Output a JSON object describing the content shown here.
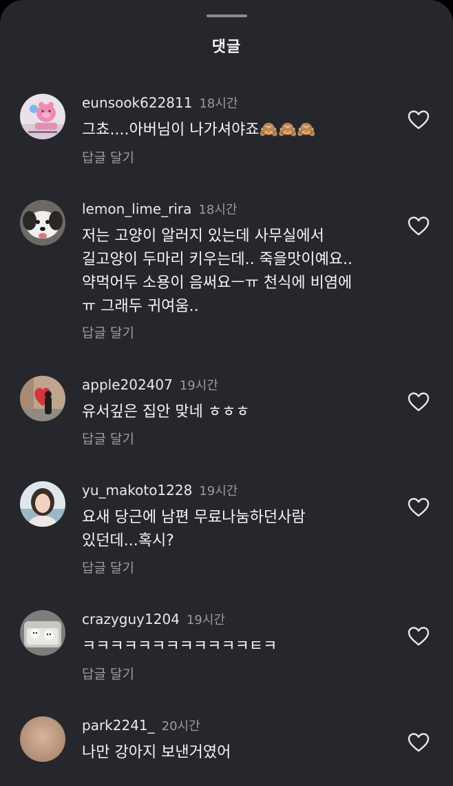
{
  "header": {
    "title": "댓글"
  },
  "comments": [
    {
      "username": "eunsook622811",
      "time": "18시간",
      "text": "그쵸....아버님이 나가셔야죠🙈🙈🙈",
      "reply_label": "답글 달기",
      "avatar_icon": "pig-plush-photo"
    },
    {
      "username": "lemon_lime_rira",
      "time": "18시간",
      "text": "저는 고양이 알러지 있는데 사무실에서\n길고양이 두마리 키우는데.. 죽을맛이예요..\n약먹어두 소용이 음써요ㅡㅠ 천식에 비염에\nㅠ 그래두 귀여움..",
      "reply_label": "답글 달기",
      "avatar_icon": "white-dog-photo"
    },
    {
      "username": "apple202407",
      "time": "19시간",
      "text": "유서깊은 집안 맞네 ㅎㅎㅎ",
      "reply_label": "답글 달기",
      "avatar_icon": "heart-balloon-photo"
    },
    {
      "username": "yu_makoto1228",
      "time": "19시간",
      "text": "요새 당근에 남편 무료나눔하던사람\n있던데...혹시?",
      "reply_label": "답글 달기",
      "avatar_icon": "woman-portrait-photo"
    },
    {
      "username": "crazyguy1204",
      "time": "19시간",
      "text": "ㅋㅋㅋㅋㅋㅋㅋㅋㅋㅋㅋㅋㅌㅋ",
      "reply_label": "답글 달기",
      "avatar_icon": "dogs-in-bed-photo"
    },
    {
      "username": "park2241_",
      "time": "20시간",
      "text": "나만 강아지 보낸거였어",
      "reply_label": "",
      "avatar_icon": "blurred-avatar"
    }
  ],
  "colors": {
    "background": "#25272c",
    "text": "#f6f6f8",
    "secondary": "#9a9ca2"
  }
}
